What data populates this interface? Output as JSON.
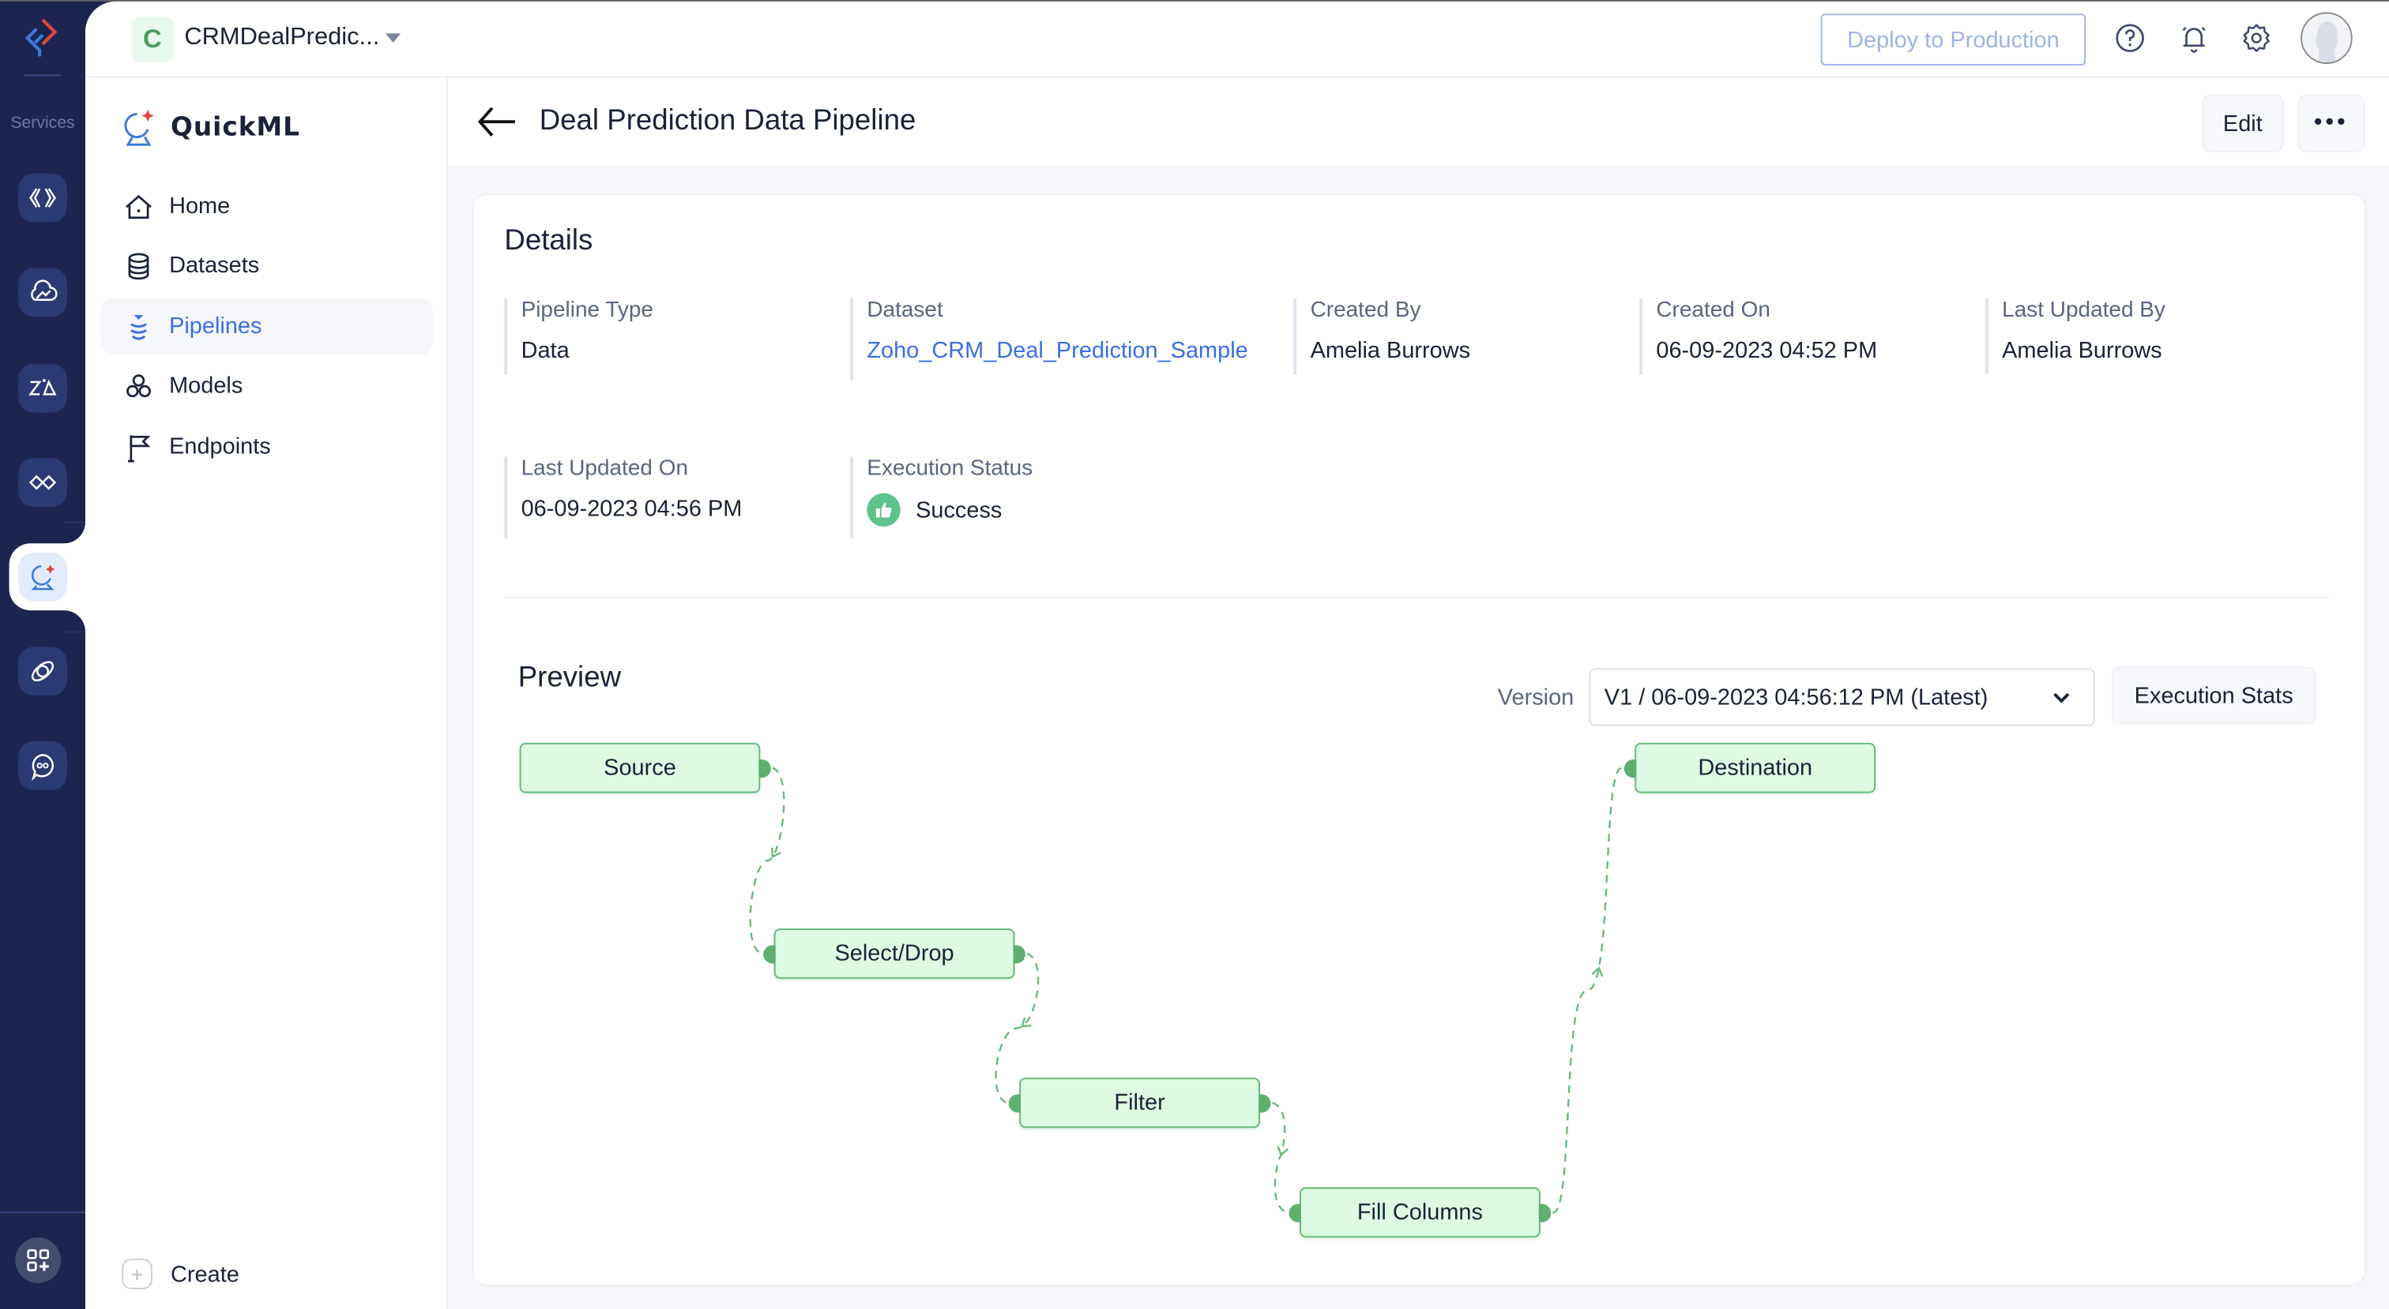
{
  "rail": {
    "services_label": "Services",
    "items": [
      {
        "icon": "code-brackets-icon",
        "active": false
      },
      {
        "icon": "cloud-analytics-icon",
        "active": false
      },
      {
        "icon": "zia-icon",
        "active": false
      },
      {
        "icon": "handshake-icon",
        "active": false
      },
      {
        "icon": "quickml-icon",
        "active": true
      },
      {
        "icon": "orbit-link-icon",
        "active": false
      },
      {
        "icon": "chat-bot-icon",
        "active": false
      }
    ],
    "apps_icon": "apps-add-icon"
  },
  "topbar": {
    "project_initial": "C",
    "project_name": "CRMDealPredic...",
    "deploy_label": "Deploy to Production",
    "icons": [
      "help-icon",
      "bell-icon",
      "gear-icon",
      "avatar"
    ]
  },
  "sidebar": {
    "brand": "QuickML",
    "items": [
      {
        "label": "Home",
        "icon": "home-icon",
        "active": false
      },
      {
        "label": "Datasets",
        "icon": "database-icon",
        "active": false
      },
      {
        "label": "Pipelines",
        "icon": "pipeline-icon",
        "active": true
      },
      {
        "label": "Models",
        "icon": "models-icon",
        "active": false
      },
      {
        "label": "Endpoints",
        "icon": "flag-icon",
        "active": false
      }
    ],
    "create_label": "Create"
  },
  "page": {
    "title": "Deal Prediction Data Pipeline",
    "edit_label": "Edit",
    "more_label": "•••"
  },
  "details": {
    "title": "Details",
    "fields": [
      {
        "label": "Pipeline Type",
        "value": "Data"
      },
      {
        "label": "Dataset",
        "value": "Zoho_CRM_Deal_Prediction_Sample",
        "link": true
      },
      {
        "label": "Created By",
        "value": "Amelia Burrows"
      },
      {
        "label": "Created On",
        "value": "06-09-2023 04:52 PM"
      },
      {
        "label": "Last Updated By",
        "value": "Amelia Burrows"
      },
      {
        "label": "Last Updated On",
        "value": "06-09-2023 04:56 PM"
      },
      {
        "label": "Execution Status",
        "value": "Success",
        "status_color": "#5ec38a"
      }
    ]
  },
  "preview": {
    "title": "Preview",
    "version_label": "Version",
    "version_value": "V1 / 06-09-2023 04:56:12 PM (Latest)",
    "exec_stats_label": "Execution Stats",
    "nodes": [
      {
        "label": "Source"
      },
      {
        "label": "Select/Drop"
      },
      {
        "label": "Filter"
      },
      {
        "label": "Fill Columns"
      },
      {
        "label": "Destination"
      }
    ],
    "edges": [
      {
        "from": "Source",
        "to": "Select/Drop"
      },
      {
        "from": "Select/Drop",
        "to": "Filter"
      },
      {
        "from": "Filter",
        "to": "Fill Columns"
      },
      {
        "from": "Fill Columns",
        "to": "Destination"
      }
    ],
    "node_fill": "#ddfbe3",
    "node_border": "#66b877"
  },
  "colors": {
    "rail_bg": "#1c2450",
    "accent": "#3a6fe0",
    "success": "#5ec38a"
  }
}
